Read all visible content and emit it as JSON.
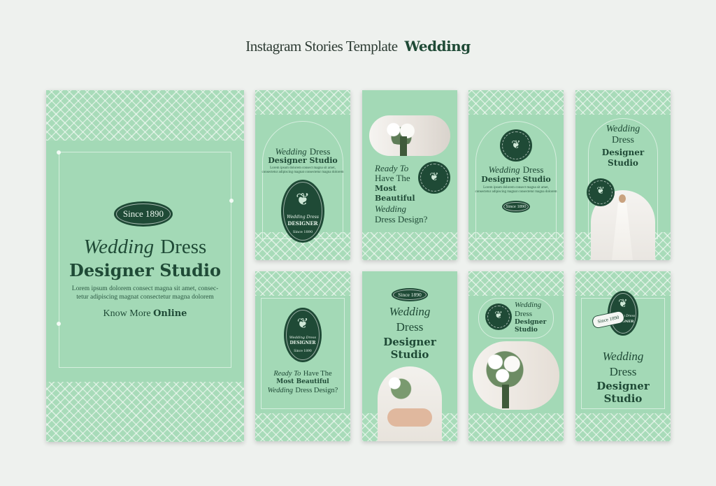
{
  "header": {
    "title_light": "Instagram Stories Template",
    "title_bold": "Wedding"
  },
  "brand": {
    "since": "Since 1890",
    "wedding": "Wedding",
    "dress": "Dress",
    "designer_studio": "Designer Studio",
    "designer": "Designer",
    "studio": "Studio",
    "wedding_dress": "Wedding Dress",
    "logo_line1": "Wedding Dress",
    "logo_line2": "DESIGNER",
    "logo_since": "Since 1890"
  },
  "main_card": {
    "body_line1": "Lorem ipsum dolorem consect magna sit amet, consec-",
    "body_line2": "tetur adipiscing magnat consectetur magna dolorem",
    "cta_light": "Know More",
    "cta_bold": "Online"
  },
  "card_small": {
    "body_line1": "Lorem ipsum dolorem consect magna sit amet,",
    "body_line2": "consectetur adipiscing magnat consectetur magna dolorem",
    "body_line3": "diciti"
  },
  "card3": {
    "l1": "Ready To",
    "l2": "Have The",
    "l3": "Most",
    "l4": "Beautiful",
    "l5": "Wedding",
    "l6": "Dress Design?"
  },
  "card6": {
    "l1": "Ready To",
    "l1b": "Have The",
    "l2": "Most Beautiful",
    "l3a": "Wedding",
    "l3b": "Dress Design?"
  },
  "colors": {
    "card": "#a3d9b6",
    "dark": "#1f4a36",
    "bg": "#eef1ee"
  }
}
